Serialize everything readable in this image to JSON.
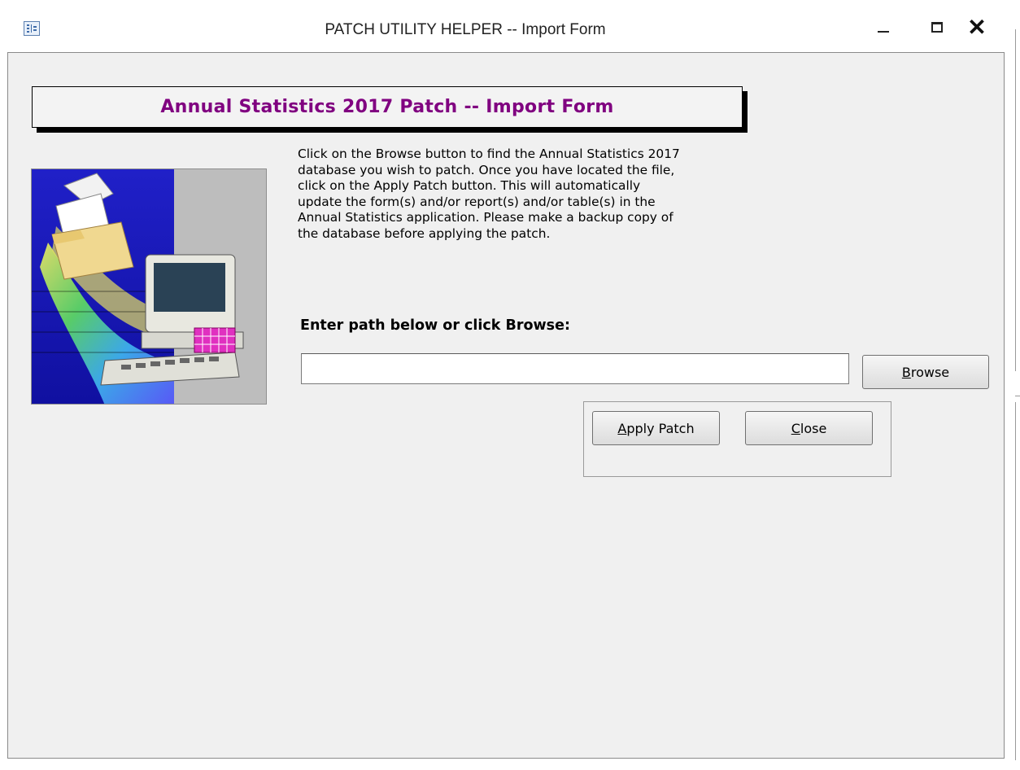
{
  "window": {
    "title": "PATCH UTILITY HELPER -- Import Form",
    "icon": "form-icon",
    "controls": {
      "minimize": "minimize-icon",
      "maximize": "maximize-icon",
      "close": "✕"
    }
  },
  "form": {
    "header_title": "Annual Statistics 2017 Patch -- Import Form",
    "header_color": "#800080",
    "background": "#f0f0f0",
    "description": "Click on the Browse button to find the Annual Statistics 2017\ndatabase you wish to patch.  Once you have located the file,\nclick on the Apply Patch button.  This will automatically\nupdate the form(s) and/or report(s) and/or table(s) in the\nAnnual Statistics application.  Please make a backup copy of\nthe database before applying the patch.",
    "path_label": "Enter path below or click Browse:",
    "path_value": "",
    "buttons": {
      "browse": {
        "label": "Browse",
        "access_key": "B",
        "rest": "rowse"
      },
      "apply_patch": {
        "label": "Apply Patch",
        "access_key": "A",
        "rest": "pply Patch"
      },
      "close": {
        "label": "Close",
        "access_key": "C",
        "rest": "lose"
      }
    },
    "picture": "computer-files-clipart"
  }
}
